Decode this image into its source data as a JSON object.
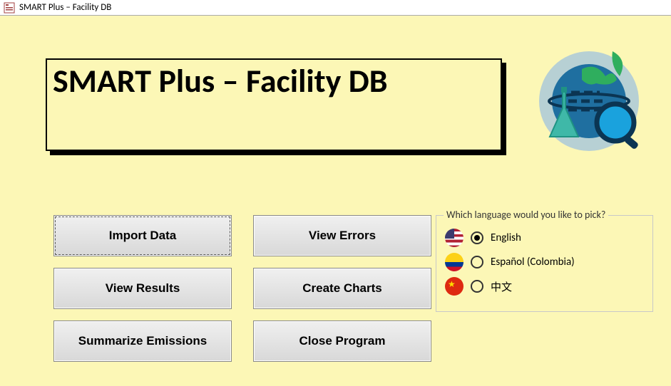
{
  "window": {
    "title": "SMART Plus – Facility DB"
  },
  "banner": {
    "title": "SMART Plus – Facility DB"
  },
  "buttons": {
    "import_data": "Import Data",
    "view_errors": "View Errors",
    "view_results": "View Results",
    "create_charts": "Create Charts",
    "summarize_emissions": "Summarize Emissions",
    "close_program": "Close Program"
  },
  "language_group": {
    "legend": "Which language would you like to pick?",
    "options": {
      "english": "English",
      "spanish": "Español (Colombia)",
      "chinese": "中文"
    },
    "selected": "english"
  }
}
